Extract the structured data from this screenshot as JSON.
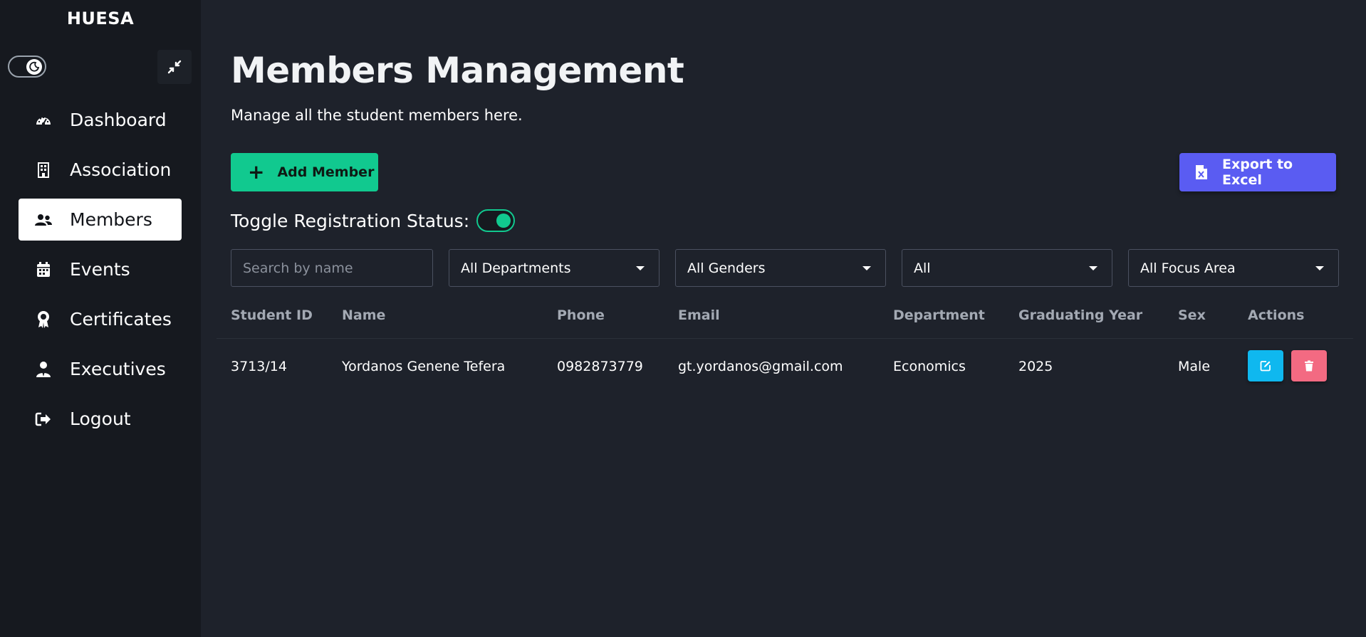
{
  "sidebar": {
    "brand": "HUESA",
    "items": [
      {
        "label": "Dashboard",
        "icon": "gauge-icon"
      },
      {
        "label": "Association",
        "icon": "building-icon"
      },
      {
        "label": "Members",
        "icon": "users-icon",
        "active": true
      },
      {
        "label": "Events",
        "icon": "calendar-icon"
      },
      {
        "label": "Certificates",
        "icon": "award-icon"
      },
      {
        "label": "Executives",
        "icon": "user-tie-icon"
      },
      {
        "label": "Logout",
        "icon": "logout-icon"
      }
    ]
  },
  "header": {
    "title": "Members Management",
    "subtitle": "Manage all the student members here."
  },
  "actions": {
    "add_label": "Add Member",
    "export_label": "Export to Excel",
    "registration_label": "Toggle Registration Status:",
    "registration_on": true
  },
  "filters": {
    "search_placeholder": "Search by name",
    "department": "All Departments",
    "gender": "All Genders",
    "year": "All",
    "focus_area": "All Focus Area"
  },
  "table": {
    "columns": [
      "Student ID",
      "Name",
      "Phone",
      "Email",
      "Department",
      "Graduating Year",
      "Sex",
      "Actions"
    ],
    "rows": [
      {
        "student_id": "3713/14",
        "name": "Yordanos Genene Tefera",
        "phone": "0982873779",
        "email": "gt.yordanos@gmail.com",
        "department": "Economics",
        "graduating_year": "2025",
        "sex": "Male"
      }
    ]
  },
  "colors": {
    "sidebar_bg": "#16191f",
    "main_bg": "#1e222b",
    "accent_green": "#11c98f",
    "accent_purple": "#5a5cf2",
    "edit_blue": "#0fb8ef",
    "delete_pink": "#f36a82"
  }
}
